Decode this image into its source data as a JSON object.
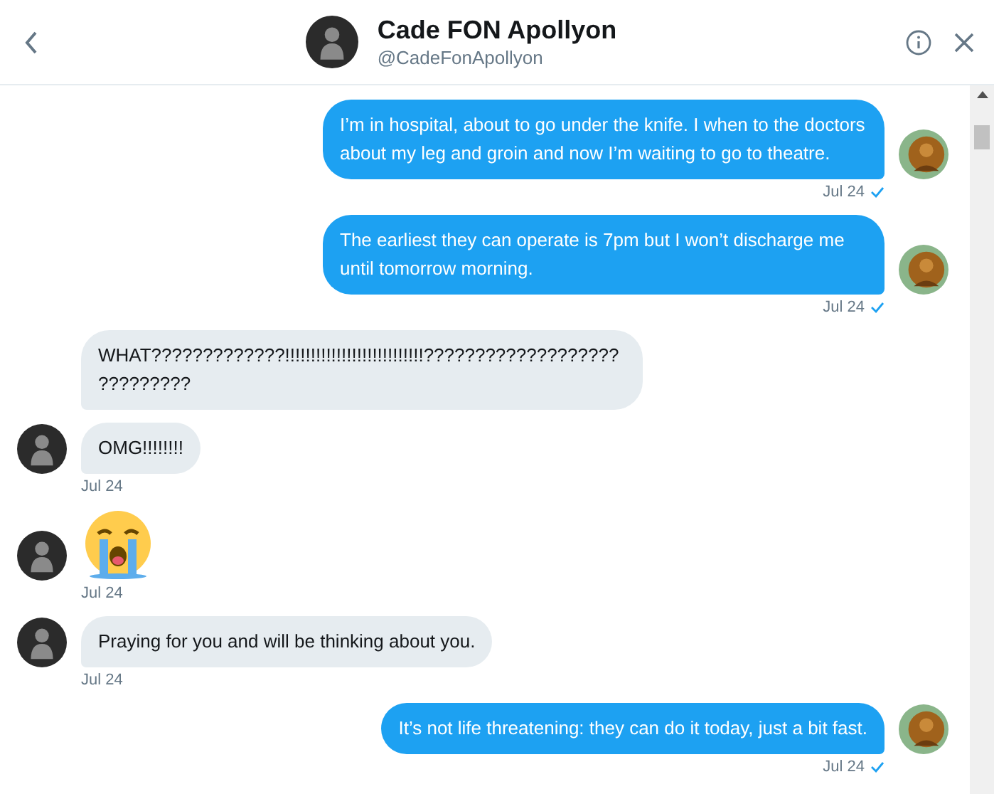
{
  "header": {
    "name": "Cade FON Apollyon",
    "handle": "@CadeFonApollyon"
  },
  "messages": [
    {
      "kind": "sent_text",
      "text": "I’m in hospital, about to go under the knife. I when to the doctors about my leg and groin and now I’m waiting to go to theatre.",
      "avatar": true,
      "time": "Jul 24",
      "read": true
    },
    {
      "kind": "sent_text",
      "text": "The earliest they can operate is 7pm but I won’t discharge me until tomorrow morning.",
      "avatar": true,
      "time": "Jul 24",
      "read": true
    },
    {
      "kind": "received_text",
      "text": "WHAT?????????????!!!!!!!!!!!!!!!!!!!!!!!!!!!????????????????????????????",
      "avatar": false
    },
    {
      "kind": "received_text",
      "text": "OMG!!!!!!!!",
      "avatar": true,
      "time": "Jul 24"
    },
    {
      "kind": "received_emoji",
      "avatar": true,
      "time": "Jul 24"
    },
    {
      "kind": "received_text",
      "text": "Praying for you and will be thinking about you.",
      "avatar": true,
      "time": "Jul 24"
    },
    {
      "kind": "sent_text",
      "text": "It’s not life threatening: they can do it today, just a bit fast.",
      "avatar": true,
      "time": "Jul 24",
      "read": true
    }
  ]
}
